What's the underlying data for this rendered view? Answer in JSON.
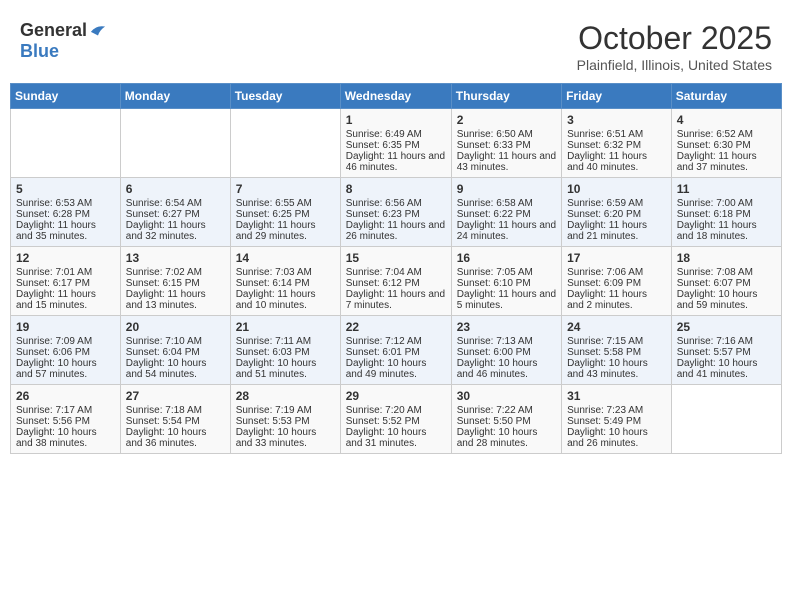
{
  "header": {
    "logo_general": "General",
    "logo_blue": "Blue",
    "month_title": "October 2025",
    "location": "Plainfield, Illinois, United States"
  },
  "days_of_week": [
    "Sunday",
    "Monday",
    "Tuesday",
    "Wednesday",
    "Thursday",
    "Friday",
    "Saturday"
  ],
  "weeks": [
    [
      {
        "day": "",
        "content": ""
      },
      {
        "day": "",
        "content": ""
      },
      {
        "day": "",
        "content": ""
      },
      {
        "day": "1",
        "content": "Sunrise: 6:49 AM\nSunset: 6:35 PM\nDaylight: 11 hours and 46 minutes."
      },
      {
        "day": "2",
        "content": "Sunrise: 6:50 AM\nSunset: 6:33 PM\nDaylight: 11 hours and 43 minutes."
      },
      {
        "day": "3",
        "content": "Sunrise: 6:51 AM\nSunset: 6:32 PM\nDaylight: 11 hours and 40 minutes."
      },
      {
        "day": "4",
        "content": "Sunrise: 6:52 AM\nSunset: 6:30 PM\nDaylight: 11 hours and 37 minutes."
      }
    ],
    [
      {
        "day": "5",
        "content": "Sunrise: 6:53 AM\nSunset: 6:28 PM\nDaylight: 11 hours and 35 minutes."
      },
      {
        "day": "6",
        "content": "Sunrise: 6:54 AM\nSunset: 6:27 PM\nDaylight: 11 hours and 32 minutes."
      },
      {
        "day": "7",
        "content": "Sunrise: 6:55 AM\nSunset: 6:25 PM\nDaylight: 11 hours and 29 minutes."
      },
      {
        "day": "8",
        "content": "Sunrise: 6:56 AM\nSunset: 6:23 PM\nDaylight: 11 hours and 26 minutes."
      },
      {
        "day": "9",
        "content": "Sunrise: 6:58 AM\nSunset: 6:22 PM\nDaylight: 11 hours and 24 minutes."
      },
      {
        "day": "10",
        "content": "Sunrise: 6:59 AM\nSunset: 6:20 PM\nDaylight: 11 hours and 21 minutes."
      },
      {
        "day": "11",
        "content": "Sunrise: 7:00 AM\nSunset: 6:18 PM\nDaylight: 11 hours and 18 minutes."
      }
    ],
    [
      {
        "day": "12",
        "content": "Sunrise: 7:01 AM\nSunset: 6:17 PM\nDaylight: 11 hours and 15 minutes."
      },
      {
        "day": "13",
        "content": "Sunrise: 7:02 AM\nSunset: 6:15 PM\nDaylight: 11 hours and 13 minutes."
      },
      {
        "day": "14",
        "content": "Sunrise: 7:03 AM\nSunset: 6:14 PM\nDaylight: 11 hours and 10 minutes."
      },
      {
        "day": "15",
        "content": "Sunrise: 7:04 AM\nSunset: 6:12 PM\nDaylight: 11 hours and 7 minutes."
      },
      {
        "day": "16",
        "content": "Sunrise: 7:05 AM\nSunset: 6:10 PM\nDaylight: 11 hours and 5 minutes."
      },
      {
        "day": "17",
        "content": "Sunrise: 7:06 AM\nSunset: 6:09 PM\nDaylight: 11 hours and 2 minutes."
      },
      {
        "day": "18",
        "content": "Sunrise: 7:08 AM\nSunset: 6:07 PM\nDaylight: 10 hours and 59 minutes."
      }
    ],
    [
      {
        "day": "19",
        "content": "Sunrise: 7:09 AM\nSunset: 6:06 PM\nDaylight: 10 hours and 57 minutes."
      },
      {
        "day": "20",
        "content": "Sunrise: 7:10 AM\nSunset: 6:04 PM\nDaylight: 10 hours and 54 minutes."
      },
      {
        "day": "21",
        "content": "Sunrise: 7:11 AM\nSunset: 6:03 PM\nDaylight: 10 hours and 51 minutes."
      },
      {
        "day": "22",
        "content": "Sunrise: 7:12 AM\nSunset: 6:01 PM\nDaylight: 10 hours and 49 minutes."
      },
      {
        "day": "23",
        "content": "Sunrise: 7:13 AM\nSunset: 6:00 PM\nDaylight: 10 hours and 46 minutes."
      },
      {
        "day": "24",
        "content": "Sunrise: 7:15 AM\nSunset: 5:58 PM\nDaylight: 10 hours and 43 minutes."
      },
      {
        "day": "25",
        "content": "Sunrise: 7:16 AM\nSunset: 5:57 PM\nDaylight: 10 hours and 41 minutes."
      }
    ],
    [
      {
        "day": "26",
        "content": "Sunrise: 7:17 AM\nSunset: 5:56 PM\nDaylight: 10 hours and 38 minutes."
      },
      {
        "day": "27",
        "content": "Sunrise: 7:18 AM\nSunset: 5:54 PM\nDaylight: 10 hours and 36 minutes."
      },
      {
        "day": "28",
        "content": "Sunrise: 7:19 AM\nSunset: 5:53 PM\nDaylight: 10 hours and 33 minutes."
      },
      {
        "day": "29",
        "content": "Sunrise: 7:20 AM\nSunset: 5:52 PM\nDaylight: 10 hours and 31 minutes."
      },
      {
        "day": "30",
        "content": "Sunrise: 7:22 AM\nSunset: 5:50 PM\nDaylight: 10 hours and 28 minutes."
      },
      {
        "day": "31",
        "content": "Sunrise: 7:23 AM\nSunset: 5:49 PM\nDaylight: 10 hours and 26 minutes."
      },
      {
        "day": "",
        "content": ""
      }
    ]
  ]
}
